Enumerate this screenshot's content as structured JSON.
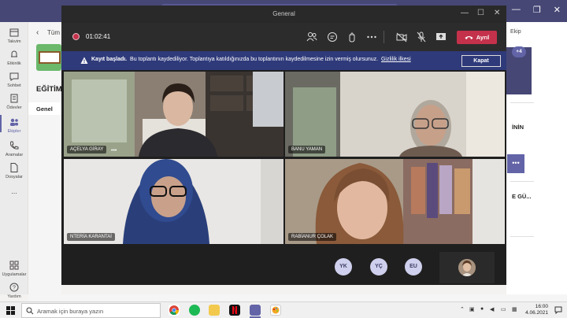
{
  "background_app": {
    "back_label": "Tüm e",
    "team_title": "EĞİTİM",
    "channel": "Genel",
    "rail": [
      {
        "label": "Takvim",
        "icon": "calendar-icon"
      },
      {
        "label": "Etkinlik",
        "icon": "bell-icon"
      },
      {
        "label": "Sohbet",
        "icon": "chat-icon"
      },
      {
        "label": "Ödevler",
        "icon": "assignments-icon"
      },
      {
        "label": "Ekipler",
        "icon": "teams-icon"
      },
      {
        "label": "Aramalar",
        "icon": "phone-icon"
      },
      {
        "label": "Dosyalar",
        "icon": "file-icon"
      },
      {
        "label": "...",
        "icon": "more-icon"
      },
      {
        "label": "Uygulamalar",
        "icon": "apps-icon"
      },
      {
        "label": "Yardım",
        "icon": "help-icon"
      }
    ],
    "right_panel": {
      "ekip_label": "Ekip",
      "plus_badge": "+4",
      "text1": "İNİN",
      "dots": "•••",
      "text2": "E GÜ..."
    }
  },
  "meeting": {
    "window_title": "General",
    "timer": "01:02:41",
    "leave_label": "Ayrıl",
    "banner": {
      "bold": "Kayıt başladı.",
      "message": "Bu toplantı kaydediliyor. Toplantıya katıldığınızda bu toplantının kaydedilmesine izin vermiş olursunuz.",
      "link": "Gizlilik ilkesi",
      "close": "Kapat"
    },
    "participants": [
      {
        "name": "AÇELYA GİRAY",
        "more": "•••"
      },
      {
        "name": "BANU YAMAN"
      },
      {
        "name": "NTERİA KARANTAİ"
      },
      {
        "name": "RABİANUR ÇOLAK"
      }
    ],
    "avatars": [
      "YK",
      "YÇ",
      "EU"
    ]
  },
  "taskbar": {
    "search_placeholder": "Aramak için buraya yazın",
    "time": "16:00",
    "date": "4.06.2021"
  },
  "colors": {
    "teams_purple": "#464775",
    "accent": "#6264a7",
    "leave_red": "#c4314b",
    "banner_blue": "#2f3a7a"
  }
}
